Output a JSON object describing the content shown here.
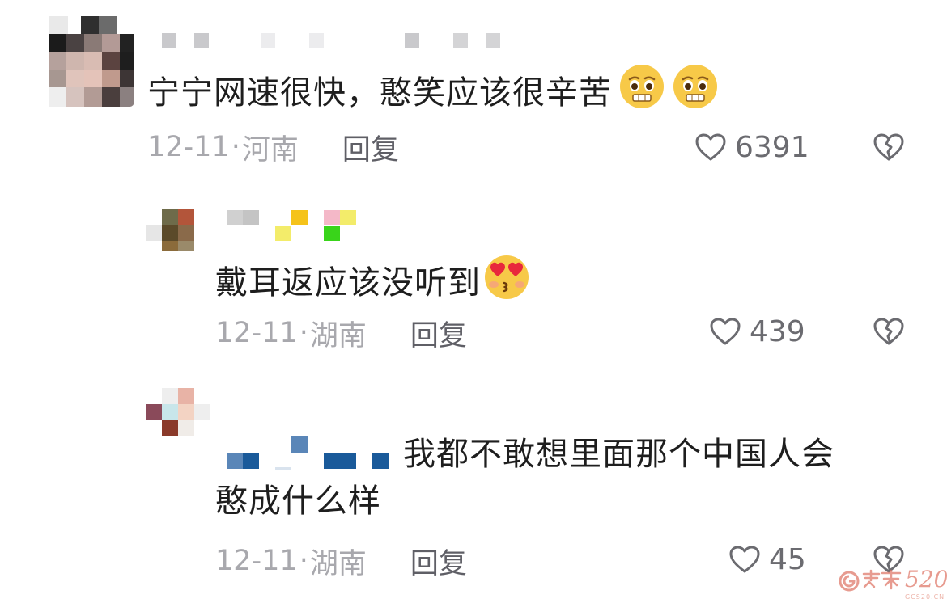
{
  "comments": [
    {
      "text": "宁宁网速很快，憨笑应该很辛苦",
      "emoji": [
        "pleading-grimace-emoji",
        "pleading-grimace-emoji"
      ],
      "date": "12-11",
      "sep": "·",
      "location": "河南",
      "reply_label": "回复",
      "likes": "6391"
    },
    {
      "text": "戴耳返应该没听到",
      "emoji": [
        "heart-eyes-kiss-emoji"
      ],
      "date": "12-11",
      "sep": "·",
      "location": "湖南",
      "reply_label": "回复",
      "likes": "439"
    },
    {
      "text_line1": "我都不敢想里面那个中国人会",
      "text_line2": "憨成什么样",
      "date": "12-11",
      "sep": "·",
      "location": "湖南",
      "reply_label": "回复",
      "likes": "45"
    }
  ],
  "icons": {
    "like": "heart-outline-icon",
    "dislike": "broken-heart-icon"
  },
  "colors": {
    "text": "#1e1e1e",
    "meta": "#a8a8ad",
    "reply": "#5f5f66",
    "watermark": "#e07a6b"
  },
  "watermark": {
    "text": "520",
    "sub": "GCS20.CN"
  }
}
